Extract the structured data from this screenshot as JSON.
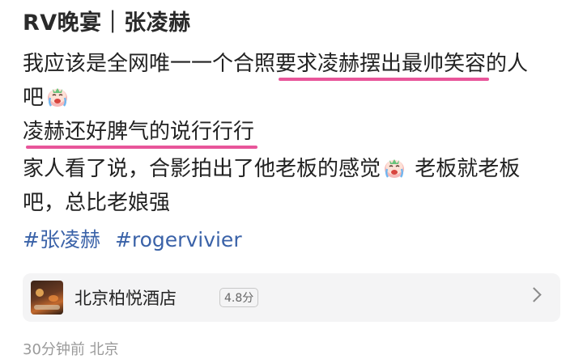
{
  "post": {
    "title": "RV晚宴｜张凌赫",
    "line1_a": "我应该是全网唯一一个合照",
    "line1_hl": "要求凌赫摆出最帅笑容",
    "line1_b": "的人",
    "line2_a": "吧",
    "line3_hl": "凌赫还好脾气的说行行行",
    "line4_a": "家人看了说，合影拍出了他老板的感觉",
    "line4_b": "老板就老板",
    "line5": "吧，总比老娘强",
    "tags": [
      "#张凌赫",
      "#rogervivier"
    ]
  },
  "place": {
    "name": "北京柏悦酒店",
    "score": "4.8分"
  },
  "meta": {
    "time_location": "30分钟前 北京"
  },
  "colors": {
    "underline": "#e8559a",
    "tag": "#3a62a8"
  },
  "icons": {
    "emoji": "crying-laughing-face-icon",
    "chevron": "chevron-right-icon"
  }
}
